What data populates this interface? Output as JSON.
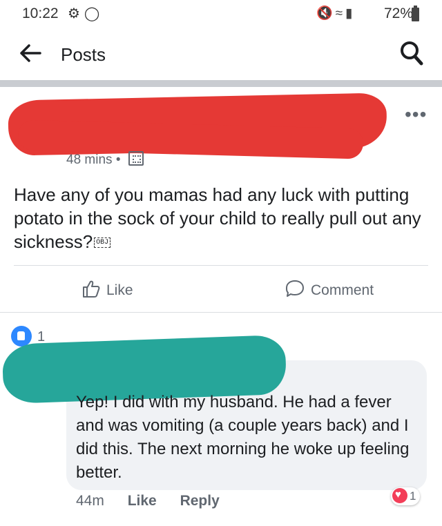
{
  "status_bar": {
    "time": "10:22",
    "battery": "72%"
  },
  "header": {
    "title": "Posts"
  },
  "post": {
    "timestamp": "48 mins",
    "text": "Have any of you mamas had any luck with putting potato in the sock of your child to really pull out any sickness?",
    "obj_glyph": "OBJ",
    "like_label": "Like",
    "comment_label": "Comment",
    "reaction_count": "1"
  },
  "comment": {
    "text": "Yep! I did with my husband. He had a fever and was vomiting (a couple years back) and I did this. The next morning he woke up feeling better.",
    "time": "44m",
    "like_label": "Like",
    "reply_label": "Reply",
    "reaction_count": "1"
  },
  "colors": {
    "redaction_red": "#e53935",
    "redaction_teal": "#26a69a",
    "like_blue": "#2d88ff",
    "love_red": "#f33e58"
  }
}
